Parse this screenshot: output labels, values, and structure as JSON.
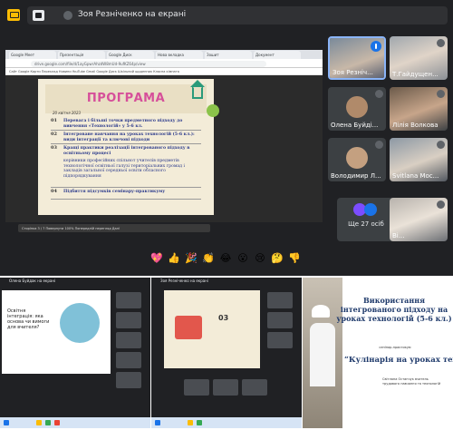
{
  "meet": {
    "presenter_label": "Зоя Резніченко на екрані",
    "browser_tabs": [
      "Google Меет",
      "Презентація",
      "Google Диск",
      "Нова вкладка",
      "Зошит",
      "Документ"
    ],
    "url": "drive.google.com/file/d/1ayGpwrAhzdW8mUd-9ufKZ64p/view",
    "bookmarks": "Сайт    Google Карти    Переклад    Новини    YouTube    Gmail    Google Диск    Шкільний щоденник    Класна кімната",
    "slide": {
      "title": "ПРОГРАМА",
      "date": "20 квітня 2023",
      "rows": [
        {
          "n": "01",
          "text": "Перевага і більші точки предметного підходу до вивчення «Технологій» у 5-6 кл.",
          "bold": true
        },
        {
          "n": "02",
          "text": "Інтегроване навчання на уроках технологій (5-6 кл.): види інтеграції та ключові підходи",
          "bold": true
        },
        {
          "n": "03",
          "text": "Кращі практики реалізації інтегрованого підходу в освітньому процесі",
          "bold": true
        },
        {
          "n": "",
          "text": "керівники професійних спільнот учителів предметів технологічної освітньої галузі територіальних громад і закладів загальної середньої освіти обласного підпорядкування",
          "bold": false
        },
        {
          "n": "04",
          "text": "Підбиття підсумків семінару-практикуму",
          "bold": true
        }
      ]
    },
    "pdf_toolbar": "Сторінка 3  /  7     Повернути     100%     Попередній перегляд     Далі",
    "tiles": [
      {
        "name": "Зоя Резніч..."
      },
      {
        "name": "Т.Гайдущен..."
      },
      {
        "name": "Олена Буйді..."
      },
      {
        "name": "Лілія Волкова"
      },
      {
        "name": "Володимир Л..."
      },
      {
        "name": "Svitlana Мос..."
      },
      {
        "name": "Ві..."
      }
    ],
    "others_count": "Ще 27 осіб",
    "reactions": [
      "💖",
      "👍",
      "🎉",
      "👏",
      "😂",
      "😮",
      "😢",
      "🤔",
      "👎"
    ]
  },
  "thumbs": {
    "t1_topbar": "Олена Буйдак на екрані",
    "t1_slide_text": "Освітня інтеграція: яка основа чи вимоги для вчителя?",
    "t2_topbar": "Зоя Резніченко на екрані",
    "t2_slide_num": "03",
    "t3": {
      "title": "Використання інтегрованого підходу на уроках технологій (5-6 кл.)",
      "subtitle": "сенінар-практикум",
      "big": "“Кулінарія на уроках технологій”",
      "author": "Світлана Остапчук вчитель трудового навчання та технологій"
    }
  }
}
